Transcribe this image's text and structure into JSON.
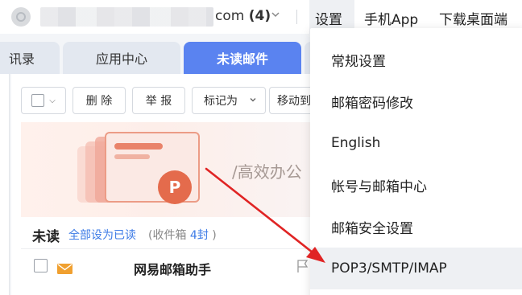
{
  "header": {
    "email_suffix": "com",
    "email_count": "(4)",
    "settings_label": "设置",
    "app_label": "手机App",
    "desktop_label": "下载桌面端"
  },
  "tabs": [
    {
      "label": "讯录"
    },
    {
      "label": "应用中心"
    },
    {
      "label": "未读邮件"
    }
  ],
  "toolbar": {
    "delete_label": "删 除",
    "report_label": "举 报",
    "mark_label": "标记为",
    "move_label": "移动到"
  },
  "banner": {
    "text": "/高效办公"
  },
  "unread": {
    "title": "未读",
    "mark_all_label": "全部设为已读",
    "inbox_prefix": "(收件箱 ",
    "inbox_count": "4封",
    "inbox_suffix": " )"
  },
  "mail_rows": [
    {
      "sender": "网易邮箱助手"
    }
  ],
  "settings_menu": {
    "items": [
      {
        "label": "常规设置"
      },
      {
        "label": "邮箱密码修改"
      },
      {
        "label": "English"
      },
      {
        "label": "帐号与邮箱中心"
      },
      {
        "label": "邮箱安全设置"
      },
      {
        "label": "POP3/SMTP/IMAP"
      }
    ],
    "highlighted": "POP3/SMTP/IMAP"
  },
  "colors": {
    "accent_tab": "#5a83f0",
    "link": "#3d7be6",
    "annotation_arrow": "#e02424",
    "envelope": "#f0a030"
  },
  "icons": [
    "avatar-icon",
    "chevron-down-icon",
    "checkbox-icon",
    "envelope-icon",
    "flag-icon",
    "ppt-icon",
    "annotation-arrow"
  ]
}
